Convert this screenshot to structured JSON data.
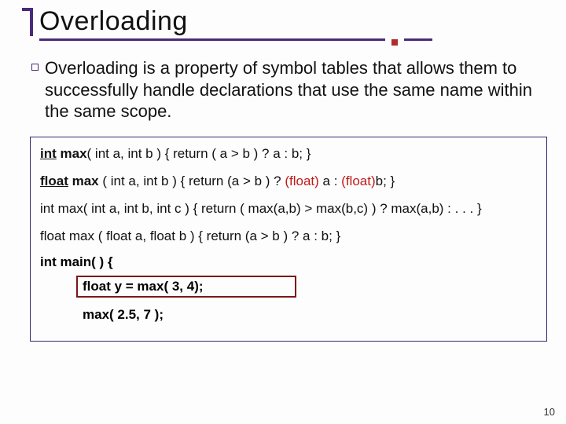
{
  "slide": {
    "title": "Overloading",
    "paragraph": "Overloading is a property of symbol tables that allows them to successfully handle declarations that use the same name within the same scope.",
    "code": {
      "line1_a": "int",
      "line1_b": " max",
      "line1_c": "( int a, int b ) { return ( a > b ) ? a : b; }",
      "line2_a": "float",
      "line2_b": " max ",
      "line2_c": "( int a, int b ) { return (a > b ) ? ",
      "line2_d": "(float)",
      "line2_e": " a : ",
      "line2_f": "(float)",
      "line2_g": "b; }",
      "line3": "int max( int a, int b, int c ) { return ( max(a,b) > max(b,c) ) ? max(a,b) : . . . }",
      "line4": "float max ( float a, float b ) { return (a > b ) ? a : b; }"
    },
    "main": {
      "header": "int main( ) {",
      "stmt1": "float y = max( 3, 4);",
      "stmt2": "max( 2.5, 7 );"
    },
    "page_number": "10"
  }
}
